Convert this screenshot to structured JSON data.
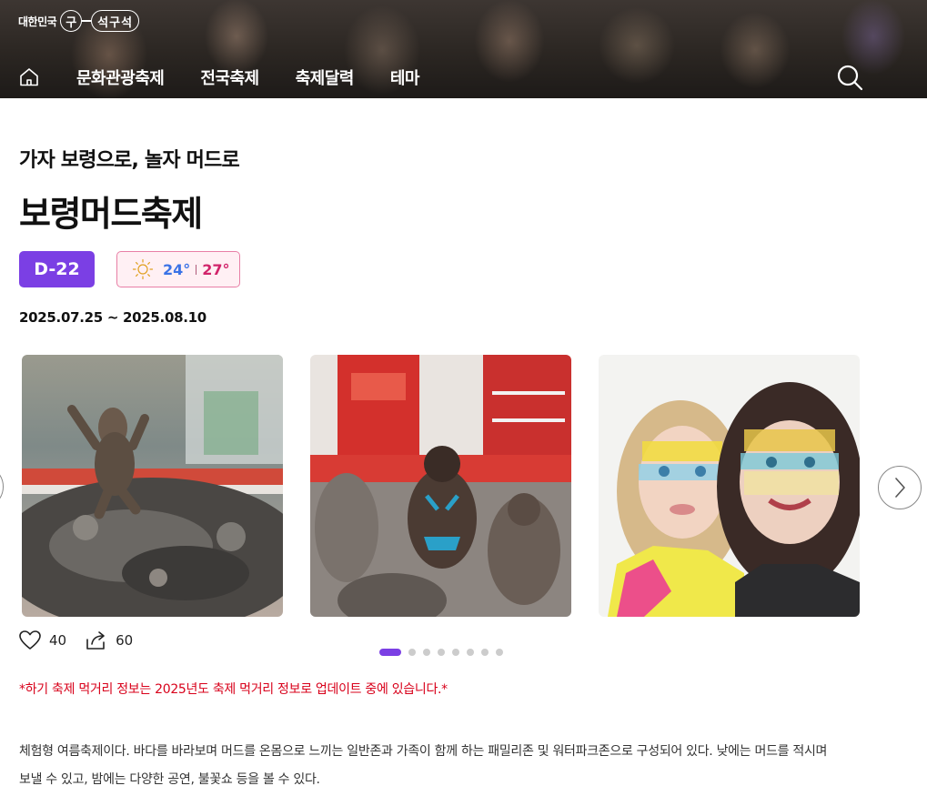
{
  "header": {
    "logo_prefix": "대한민국",
    "logo_circle": "구",
    "logo_pill": "석구석",
    "nav_items": [
      "문화관광축제",
      "전국축제",
      "축제달력",
      "테마"
    ]
  },
  "festival": {
    "subtitle": "가자 보령으로, 놀자 머드로",
    "title": "보령머드축제",
    "dday": "D-22",
    "temp_low": "24°",
    "temp_high": "27°",
    "dates": "2025.07.25 ~ 2025.08.10"
  },
  "actions": {
    "likes": "40",
    "shares": "60"
  },
  "carousel": {
    "total_pages": 8,
    "active_page": 1
  },
  "notice": "*하기 축제 먹거리 정보는 2025년도 축제 먹거리 정보로 업데이트 중에 있습니다.*",
  "description": "체험형 여름축제이다. 바다를 바라보며 머드를 온몸으로 느끼는 일반존과 가족이 함께 하는 패밀리존 및 워터파크존으로 구성되어 있다. 낮에는 머드를 적시며 보낼 수 있고, 밤에는 다양한 공연, 불꽃쇼 등을 볼 수 있다.",
  "icons": {
    "home": "home-icon",
    "search": "search-icon",
    "sun": "sun-icon",
    "heart": "heart-icon",
    "share": "share-icon",
    "next": "chevron-right-icon"
  },
  "colors": {
    "accent": "#7b3fe4",
    "temp_low": "#3b73e6",
    "temp_high": "#d1246a",
    "notice": "#d8001a"
  }
}
